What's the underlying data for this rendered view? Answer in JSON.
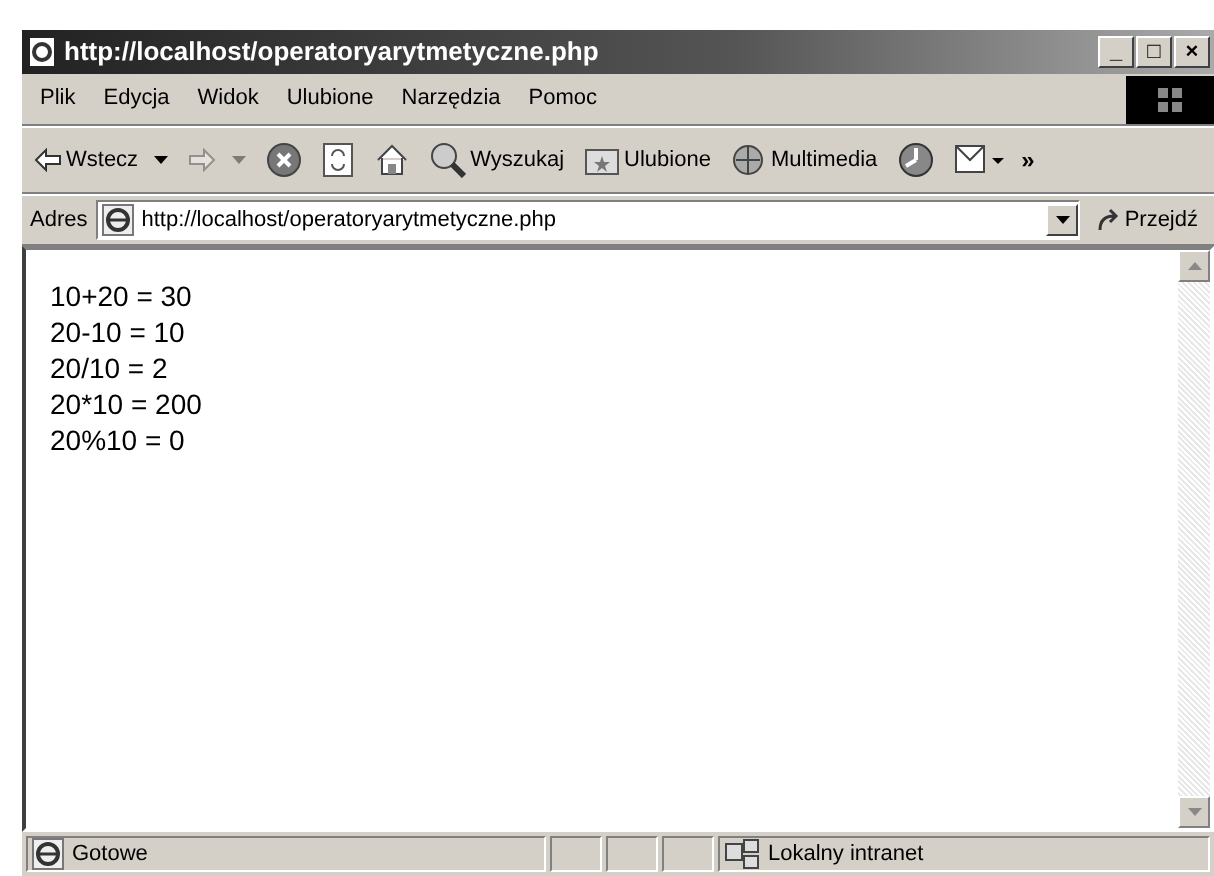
{
  "window": {
    "title": "http://localhost/operatoryarytmetyczne.php",
    "controls": [
      "_",
      "□",
      "×"
    ]
  },
  "menu": [
    "Plik",
    "Edycja",
    "Widok",
    "Ulubione",
    "Narzędzia",
    "Pomoc"
  ],
  "toolbar": [
    {
      "kind": "back",
      "label": "Wstecz",
      "disabled": false
    },
    {
      "kind": "forward",
      "disabled": true
    },
    {
      "kind": "stop",
      "disabled": false
    },
    {
      "kind": "refresh",
      "disabled": false
    },
    {
      "kind": "home",
      "disabled": false
    },
    {
      "kind": "search",
      "label": "Wyszukaj",
      "disabled": false
    },
    {
      "kind": "favorites",
      "label": "Ulubione",
      "disabled": false
    },
    {
      "kind": "media",
      "label": "Multimedia",
      "disabled": false
    },
    {
      "kind": "history",
      "disabled": false
    },
    {
      "kind": "mail",
      "disabled": false
    }
  ],
  "toolbar_overflow": "»",
  "address": {
    "label": "Adres",
    "value": "http://localhost/operatoryarytmetyczne.php",
    "go": "Przejdź"
  },
  "content": [
    "10+20 = 30",
    "20-10 = 10",
    "20/10 = 2",
    "20*10 = 200",
    "20%10 = 0"
  ],
  "status_bar": {
    "text": "Gotowe",
    "zone": "Lokalny intranet"
  }
}
